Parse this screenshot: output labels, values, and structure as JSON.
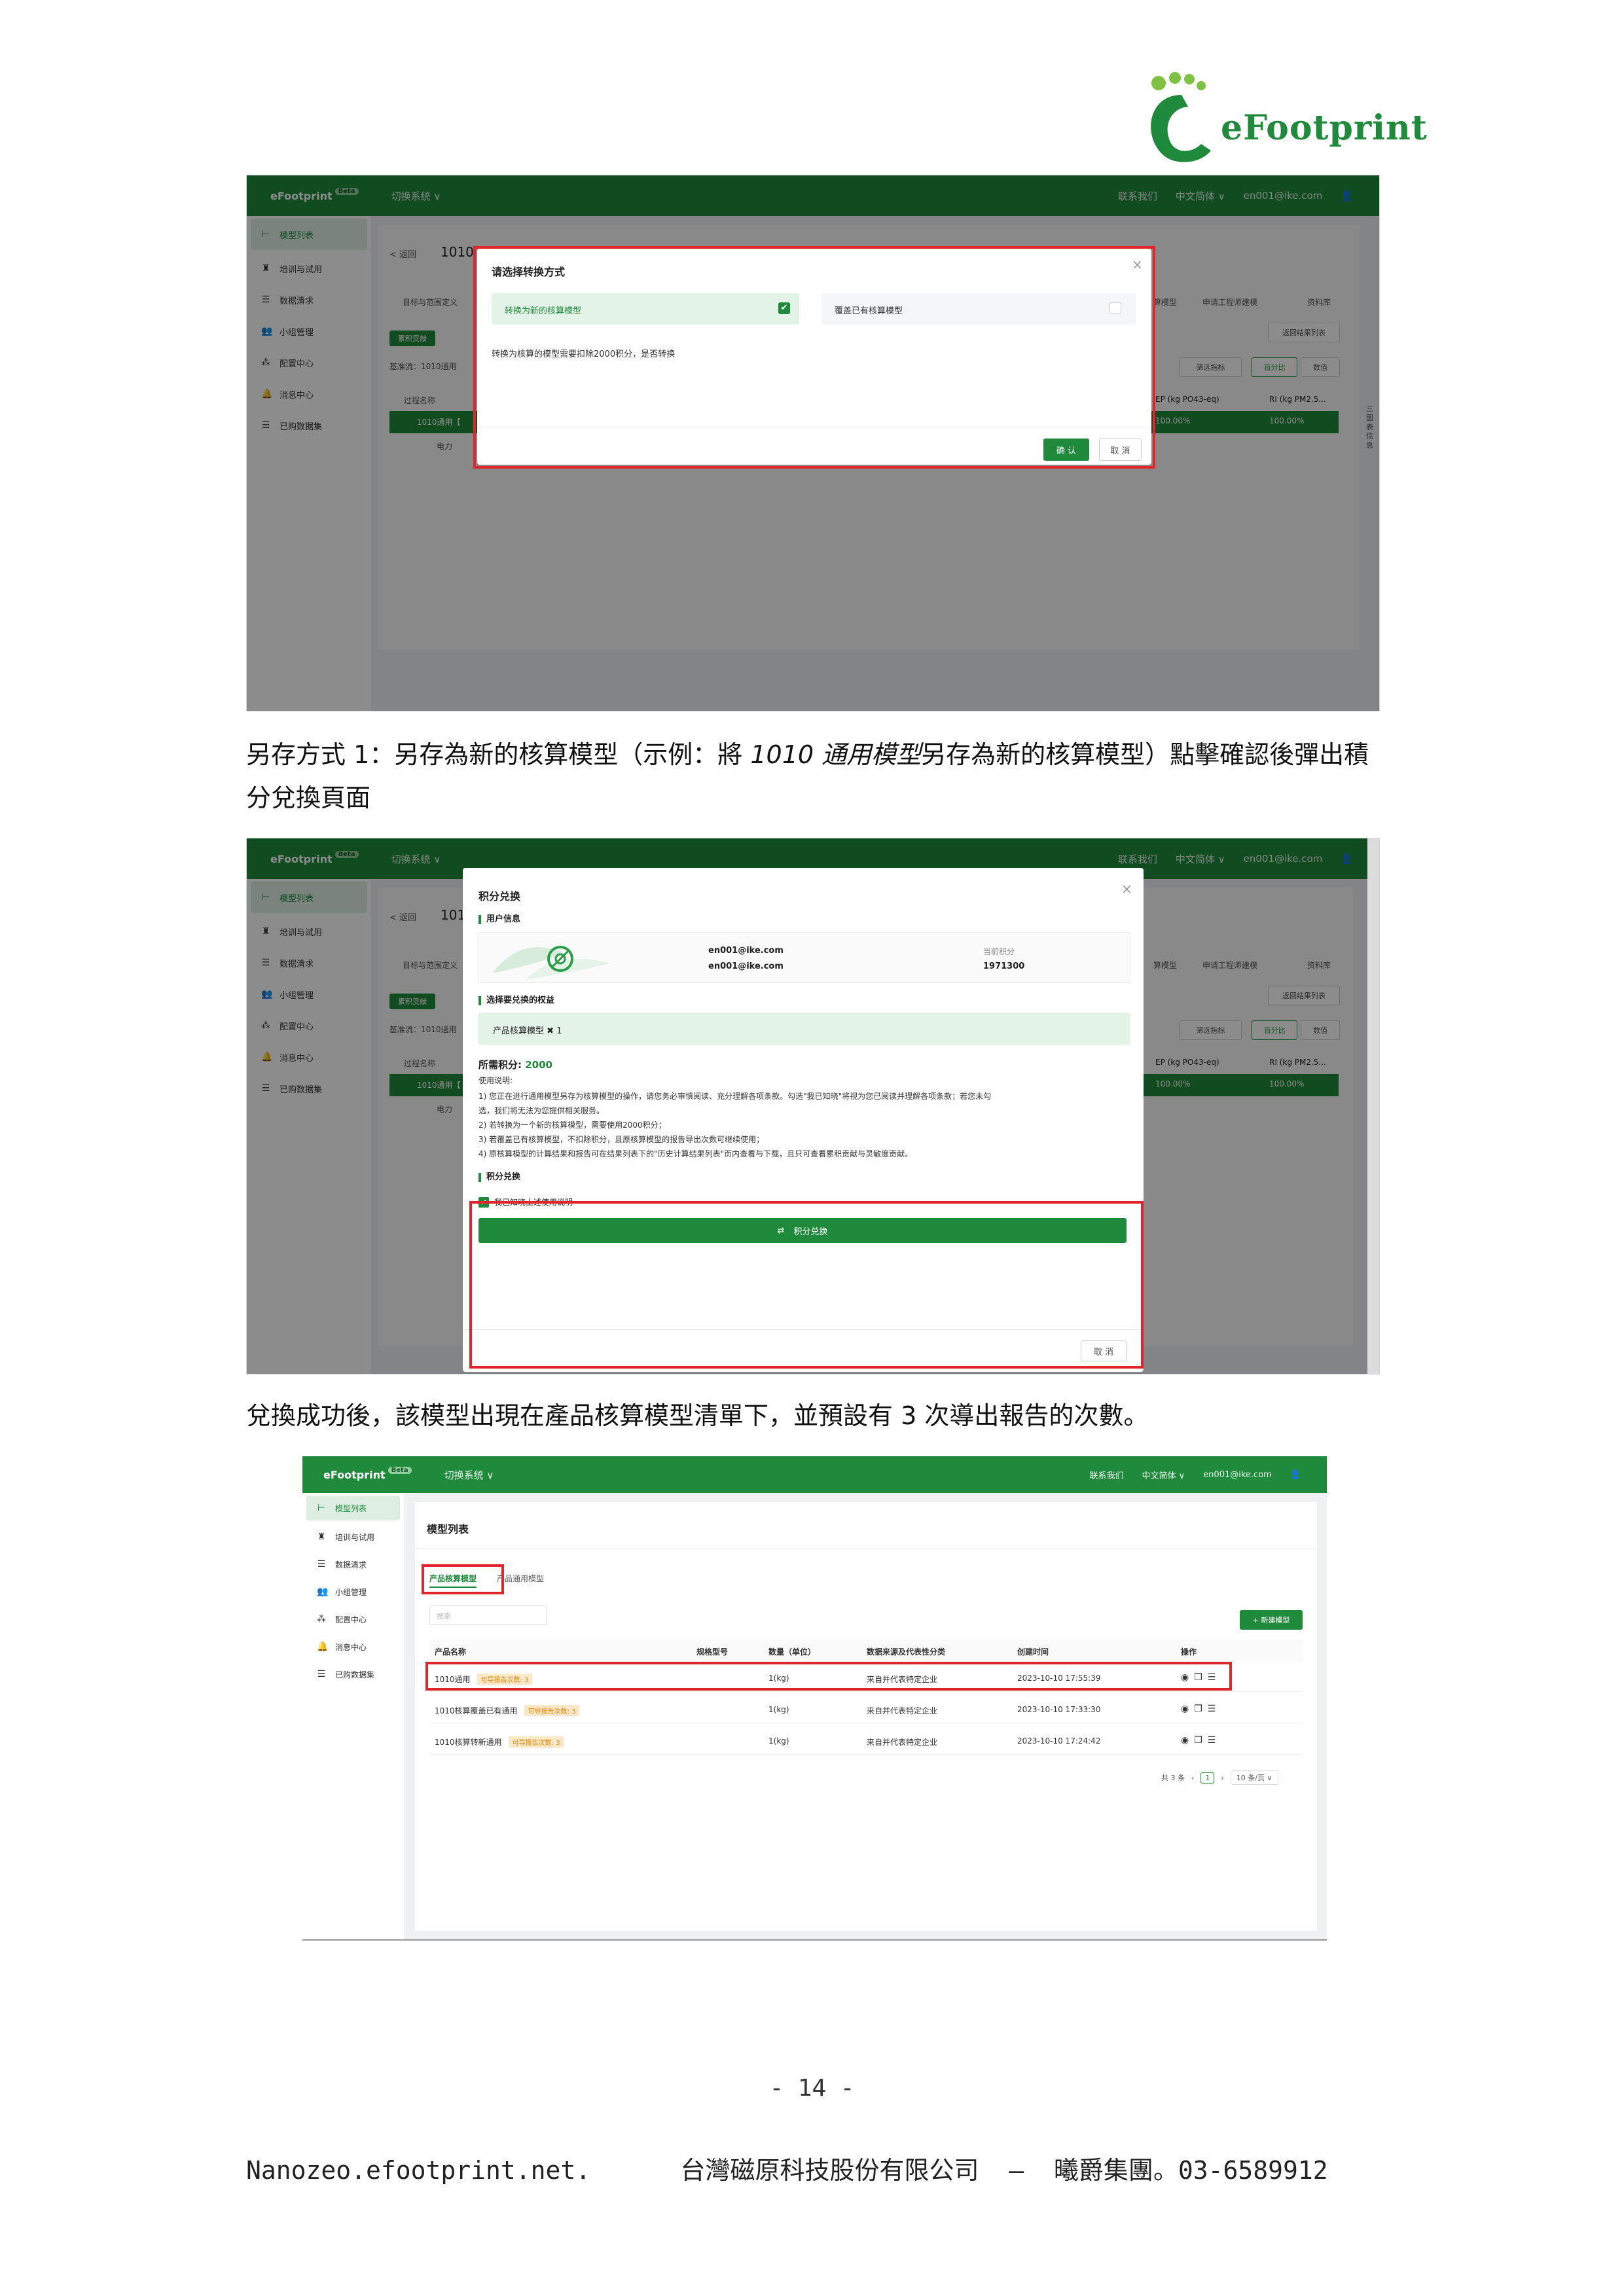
{
  "logo": {
    "brand": "eFootprint"
  },
  "app": {
    "logo_text": "eFootprint",
    "beta": "Beta",
    "system_switch": "切换系统 ∨",
    "contact": "联系我们",
    "language": "中文简体 ∨",
    "user_email": "en001@ike.com",
    "sidebar": [
      "模型列表",
      "培训与试用",
      "数据清求",
      "小组管理",
      "配置中心",
      "消息中心",
      "已购数据集"
    ],
    "back": "< 返回",
    "model_code": "1010",
    "tab_partial": "目标与范围定义",
    "tab_model": "算模型",
    "tab_apply": "申请工程师建模",
    "tab_lib": "资料库",
    "back_to_list": "返回结果列表",
    "contrib_tag": "累积贡献",
    "baseline": "基准流：1010通用",
    "filter": "筛选指标",
    "percent": "百分比",
    "number": "数值",
    "process_name": "过程名称",
    "col_ep": "EP (kg PO43-eq)",
    "col_ri": "RI (kg PM2.5...",
    "row1_name": "1010通用【",
    "row1_val": "100.00%",
    "row2_name": "电力",
    "side_tab": "三 图 表 信 息"
  },
  "modal1": {
    "title": "请选择转换方式",
    "option_new": "转换为新的核算模型",
    "option_overwrite": "覆盖已有核算模型",
    "notice": "转换为核算的模型需要扣除2000积分，是否转换",
    "confirm": "确 认",
    "cancel": "取 消"
  },
  "caption1": {
    "prefix": "另存方式 1：另存為新的核算模型（示例：將 ",
    "italic": "1010 通用模型",
    "suffix": "另存為新的核算模型）點擊確認後彈出積分兌換頁面"
  },
  "modal2": {
    "title": "积分兑换",
    "section_user": "用户信息",
    "email1": "en001@ike.com",
    "email2": "en001@ike.com",
    "points_label": "当前积分",
    "points_value": "1971300",
    "section_rights": "选择要兑换的权益",
    "right_item": "产品核算模型 ✖ 1",
    "required_label": "所需积分: ",
    "required_value": "2000",
    "usage_title": "使用说明:",
    "usage": [
      "1) 您正在进行通用模型另存为核算模型的操作，请您务必审慎阅读、充分理解各项条款。勾选\"我已知晓\"将视为您已阅读并理解各项条款；若您未勾",
      "选，我们将无法为您提供相关服务。",
      "2) 若转换为一个新的核算模型，需要使用2000积分；",
      "3) 若覆盖已有核算模型，不扣除积分，且原核算模型的报告导出次数可继续使用；",
      "4) 原核算模型的计算结果和报告可在结果列表下的\"历史计算结果列表\"页内查看与下载，且只可查看累积贡献与灵敏度贡献。"
    ],
    "section_exchange": "积分兑换",
    "agree": "我已知晓上述使用说明",
    "exchange_btn": "积分兑换",
    "cancel": "取 消"
  },
  "caption2": "兌換成功後，該模型出現在產品核算模型清單下，並預設有 3 次導出報告的次數。",
  "list": {
    "title": "模型列表",
    "tab_active": "产品核算模型",
    "tab_other": "产品通用模型",
    "search_placeholder": "搜索",
    "new_btn": "+ 新建模型",
    "headers": [
      "产品名称",
      "规格型号",
      "数量（单位）",
      "数据来源及代表性分类",
      "创建时间",
      "操作"
    ],
    "rows": [
      {
        "name": "1010通用",
        "tag": "可导报告次数: 3",
        "qty": "1(kg)",
        "source": "来自并代表特定企业",
        "time": "2023-10-10 17:55:39"
      },
      {
        "name": "1010核算覆盖已有通用",
        "tag": "可导报告次数: 3",
        "qty": "1(kg)",
        "source": "来自并代表特定企业",
        "time": "2023-10-10 17:33:30"
      },
      {
        "name": "1010核算转新通用",
        "tag": "可导报告次数: 3",
        "qty": "1(kg)",
        "source": "来自并代表特定企业",
        "time": "2023-10-10 17:24:42"
      }
    ],
    "total": "共 3 条",
    "page": "1",
    "per_page": "10 条/页 ∨"
  },
  "page_number": "- 14 -",
  "footer": "Nanozeo.efootprint.net.      台灣磁原科技股份有限公司  –  曦爵集團。03-6589912",
  "colors": {
    "brand_green": "#1f8a3b",
    "highlight_red": "#e0252c"
  }
}
